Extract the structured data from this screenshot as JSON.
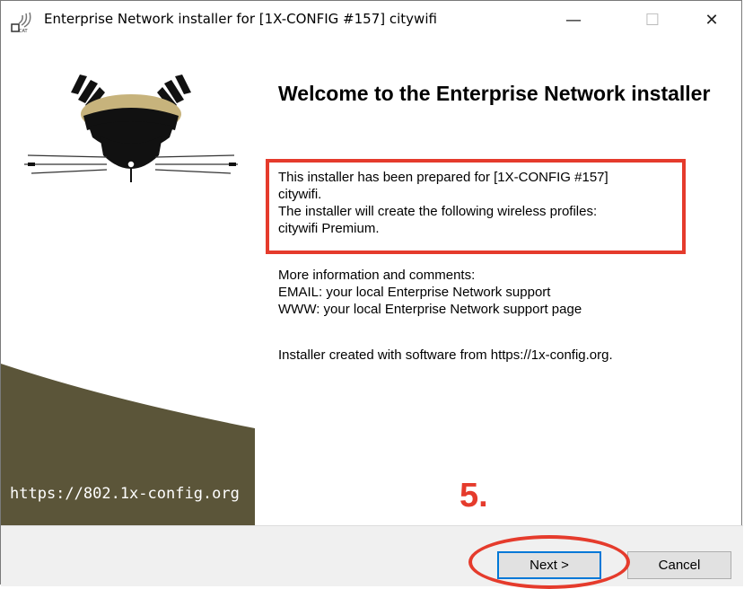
{
  "window": {
    "title": "Enterprise Network installer for [1X-CONFIG #157] citywifi",
    "controls": {
      "minimize": "—",
      "maximize": "☐",
      "close": "✕"
    }
  },
  "sidebar": {
    "url": "https://802.1x-config.org",
    "colors": {
      "band": "#5b5539",
      "logo_gold": "#c7b37c"
    }
  },
  "content": {
    "heading": "Welcome to the Enterprise Network installer",
    "intro_lines": [
      "This installer has been prepared for [1X-CONFIG #157]",
      "citywifi.",
      "The installer will create the following wireless profiles:",
      "citywifi Premium."
    ],
    "more_info_lines": [
      "More information and comments:",
      "EMAIL: your local Enterprise Network support",
      "WWW: your local Enterprise Network support page"
    ],
    "created_with": "Installer created with software from https://1x-config.org."
  },
  "buttons": {
    "next": "Next >",
    "cancel": "Cancel"
  },
  "annotations": {
    "step": "5.",
    "color": "#e53b2c"
  }
}
